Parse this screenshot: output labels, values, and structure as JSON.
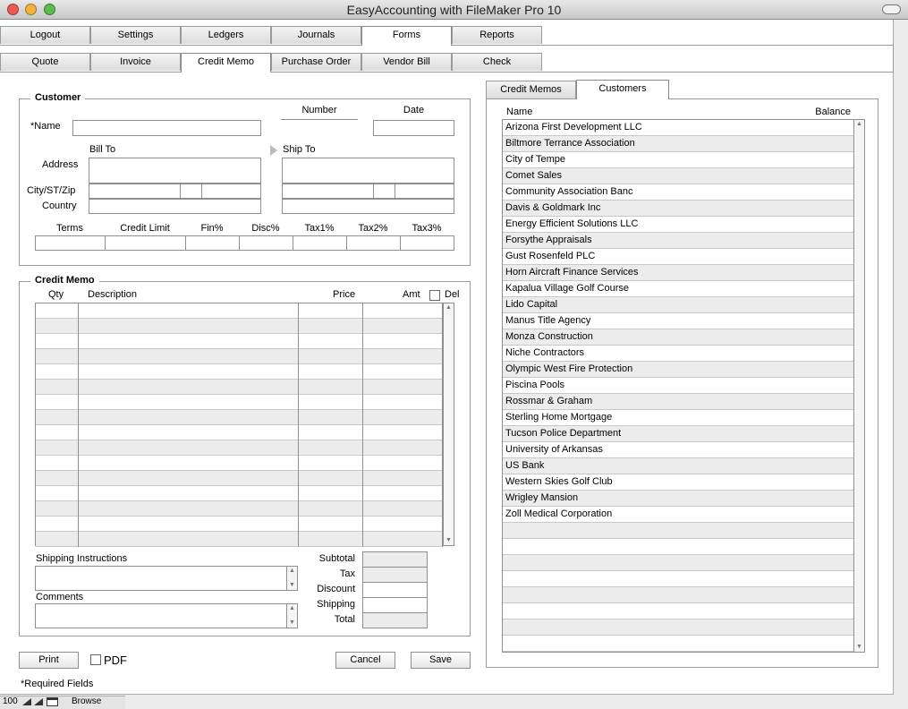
{
  "app": {
    "title": "EasyAccounting with FileMaker Pro 10"
  },
  "main_tabs": [
    {
      "label": "Logout"
    },
    {
      "label": "Settings"
    },
    {
      "label": "Ledgers"
    },
    {
      "label": "Journals"
    },
    {
      "label": "Forms",
      "selected": true
    },
    {
      "label": "Reports"
    }
  ],
  "form_tabs": [
    {
      "label": "Quote"
    },
    {
      "label": "Invoice"
    },
    {
      "label": "Credit Memo",
      "selected": true
    },
    {
      "label": "Purchase Order"
    },
    {
      "label": "Vendor Bill"
    },
    {
      "label": "Check"
    }
  ],
  "customer": {
    "group_label": "Customer",
    "name_label": "*Name",
    "number_label": "Number",
    "date_label": "Date",
    "bill_to_label": "Bill To",
    "ship_to_label": "Ship To",
    "address_label": "Address",
    "city_label": "City/ST/Zip",
    "country_label": "Country",
    "terms": [
      "Terms",
      "Credit Limit",
      "Fin%",
      "Disc%",
      "Tax1%",
      "Tax2%",
      "Tax3%"
    ]
  },
  "credit_memo": {
    "group_label": "Credit Memo",
    "col_qty": "Qty",
    "col_description": "Description",
    "col_price": "Price",
    "col_amt": "Amt",
    "del_label": "Del",
    "row_count": 16,
    "shipping_instructions_label": "Shipping Instructions",
    "comments_label": "Comments",
    "totals": [
      "Subtotal",
      "Tax",
      "Discount",
      "Shipping",
      "Total"
    ]
  },
  "buttons": {
    "print": "Print",
    "pdf": "PDF",
    "cancel": "Cancel",
    "save": "Save"
  },
  "required_note": "*Required Fields",
  "side_tabs": [
    {
      "label": "Credit Memos"
    },
    {
      "label": "Customers",
      "selected": true
    }
  ],
  "customers_list": {
    "col_name": "Name",
    "col_balance": "Balance",
    "rows": [
      "Arizona First Development LLC",
      "Biltmore Terrance Association",
      "City of Tempe",
      "Comet Sales",
      "Community Association Banc",
      "Davis & Goldmark Inc",
      "Energy Efficient Solutions LLC",
      "Forsythe Appraisals",
      "Gust Rosenfeld PLC",
      "Horn Aircraft Finance Services",
      "Kapalua Village Golf Course",
      "Lido Capital",
      "Manus Title Agency",
      "Monza Construction",
      "Niche Contractors",
      "Olympic West Fire Protection",
      "Piscina Pools",
      "Rossmar & Graham",
      "Sterling Home Mortgage",
      "Tucson Police Department",
      "University of Arkansas",
      "US Bank",
      "Western Skies Golf Club",
      "Wrigley Mansion",
      "Zoll Medical Corporation"
    ],
    "empty_rows": 8
  },
  "status_bar": {
    "zoom": "100",
    "mode": "Browse"
  },
  "colors": {
    "alt_row": "#ececec",
    "tab_selected": "#ffffff",
    "total_field": "#ececec"
  }
}
